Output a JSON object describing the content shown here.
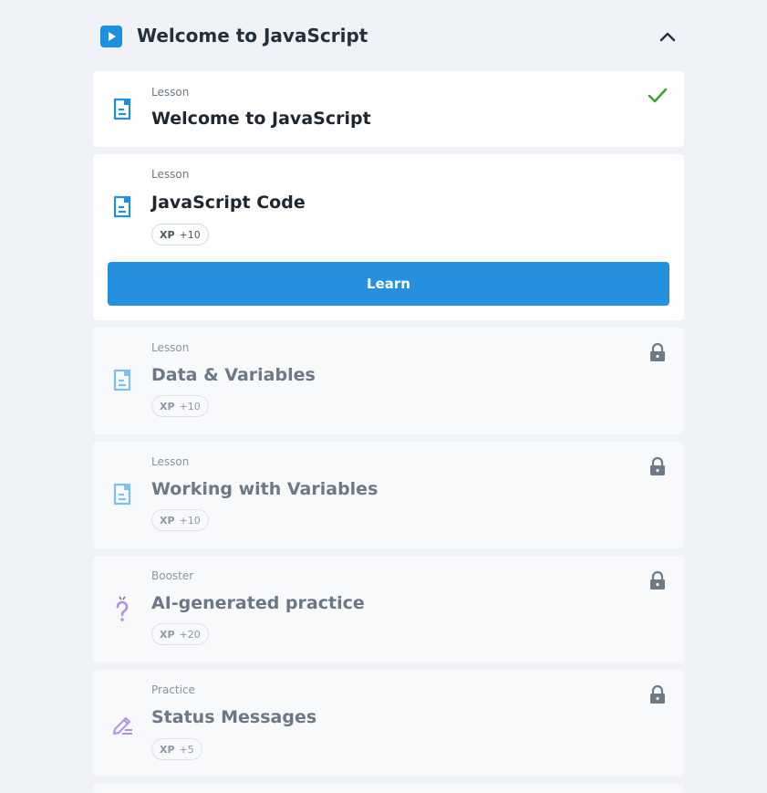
{
  "module": {
    "title": "Welcome to JavaScript",
    "icon": "play-icon",
    "collapse_icon": "chevron-up-icon"
  },
  "colors": {
    "accent": "#2490de",
    "complete": "#3aa62c",
    "lock": "#6f7a87",
    "lesson_icon": "#1f8fe0",
    "booster_icon": "#9b6ee0",
    "practice_icon": "#9b6ee0"
  },
  "items": [
    {
      "type": "Lesson",
      "title": "Welcome to JavaScript",
      "icon": "lesson-document-icon",
      "status": "completed",
      "status_icon": "checkmark-icon"
    },
    {
      "type": "Lesson",
      "title": "JavaScript Code",
      "icon": "lesson-document-icon",
      "status": "current",
      "xp_label": "XP",
      "xp_value": "+10",
      "action_label": "Learn"
    },
    {
      "type": "Lesson",
      "title": "Data & Variables",
      "icon": "lesson-document-icon",
      "status": "locked",
      "status_icon": "lock-icon",
      "xp_label": "XP",
      "xp_value": "+10"
    },
    {
      "type": "Lesson",
      "title": "Working with Variables",
      "icon": "lesson-document-icon",
      "status": "locked",
      "status_icon": "lock-icon",
      "xp_label": "XP",
      "xp_value": "+10"
    },
    {
      "type": "Booster",
      "title": "AI-generated practice",
      "icon": "ai-question-icon",
      "status": "locked",
      "status_icon": "lock-icon",
      "xp_label": "XP",
      "xp_value": "+20"
    },
    {
      "type": "Practice",
      "title": "Status Messages",
      "icon": "pencil-practice-icon",
      "status": "locked",
      "status_icon": "lock-icon",
      "xp_label": "XP",
      "xp_value": "+5"
    }
  ]
}
